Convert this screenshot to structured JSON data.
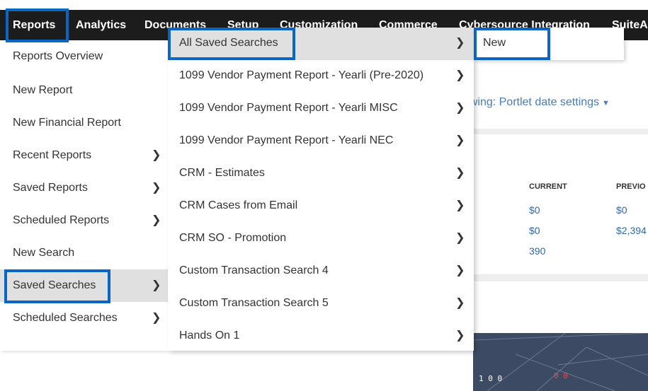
{
  "topnav": {
    "items": [
      "Reports",
      "Analytics",
      "Documents",
      "Setup",
      "Customization",
      "Commerce",
      "Cybersource Integration",
      "SuiteA"
    ]
  },
  "background": {
    "portlet_date_text": "Viewing: Portlet date settings",
    "kpi": {
      "current_header": "CURRENT",
      "previous_header": "PREVIO",
      "current_values": [
        "$0",
        "$0",
        "390"
      ],
      "previous_values": [
        "$0",
        "$2,394"
      ]
    },
    "banner_digits": [
      "1 0 0",
      "0 0"
    ]
  },
  "reports_menu": {
    "items": [
      {
        "label": "Reports Overview",
        "has_submenu": false
      },
      {
        "label": "New Report",
        "has_submenu": false
      },
      {
        "label": "New Financial Report",
        "has_submenu": false
      },
      {
        "label": "Recent Reports",
        "has_submenu": true
      },
      {
        "label": "Saved Reports",
        "has_submenu": true
      },
      {
        "label": "Scheduled Reports",
        "has_submenu": true
      },
      {
        "label": "New Search",
        "has_submenu": false
      },
      {
        "label": "Saved Searches",
        "has_submenu": true,
        "active": true
      },
      {
        "label": "Scheduled Searches",
        "has_submenu": true
      }
    ]
  },
  "saved_searches_menu": {
    "items": [
      {
        "label": "All Saved Searches",
        "active": true
      },
      {
        "label": "1099 Vendor Payment Report - Yearli (Pre-2020)"
      },
      {
        "label": "1099 Vendor Payment Report - Yearli MISC"
      },
      {
        "label": "1099 Vendor Payment Report - Yearli NEC"
      },
      {
        "label": "CRM - Estimates"
      },
      {
        "label": "CRM Cases from Email"
      },
      {
        "label": "CRM SO - Promotion"
      },
      {
        "label": "Custom Transaction Search 4"
      },
      {
        "label": "Custom Transaction Search 5"
      },
      {
        "label": "Hands On 1"
      }
    ]
  },
  "new_menu": {
    "items": [
      {
        "label": "New"
      }
    ]
  },
  "icons": {
    "chevron": "chevron-right-icon",
    "caret": "caret-down-icon"
  },
  "colors": {
    "nav_bg": "#1c1c1c",
    "highlight_border": "#0a66c2",
    "active_row": "#e0e0e0",
    "link_blue": "#2f67b1"
  }
}
